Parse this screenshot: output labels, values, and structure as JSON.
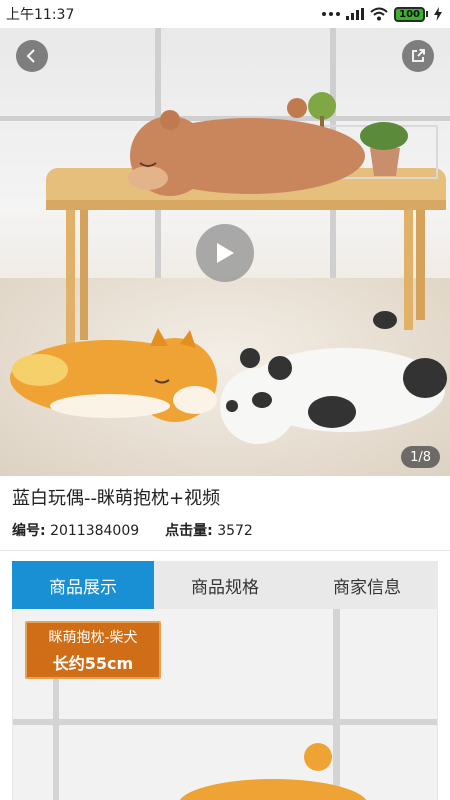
{
  "status_bar": {
    "time": "上午11:37",
    "battery": "100"
  },
  "media": {
    "page_indicator": "1/8",
    "has_video": true
  },
  "product": {
    "title": "蓝白玩偶--眯萌抱枕+视频",
    "code_label": "编号:",
    "code_value": "2011384009",
    "clicks_label": "点击量:",
    "clicks_value": "3572"
  },
  "tabs": [
    {
      "label": "商品展示",
      "active": true
    },
    {
      "label": "商品规格",
      "active": false
    },
    {
      "label": "商家信息",
      "active": false
    }
  ],
  "detail": {
    "badge_line1": "眯萌抱枕-柴犬",
    "badge_line2": "长约55cm"
  },
  "colors": {
    "accent": "#1990d4",
    "battery": "#3cb02f",
    "badge": "#d06d17"
  }
}
